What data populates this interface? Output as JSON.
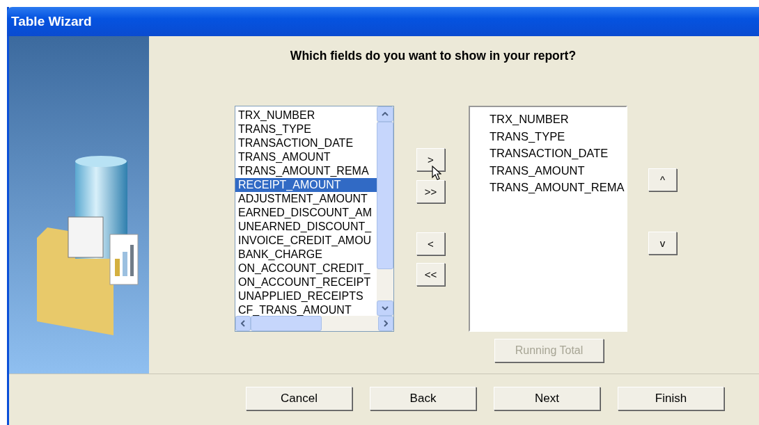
{
  "window": {
    "title": "Table Wizard"
  },
  "heading": "Which fields do you want to show in your report?",
  "available_fields": [
    {
      "label": "TRX_NUMBER",
      "selected": false
    },
    {
      "label": "TRANS_TYPE",
      "selected": false
    },
    {
      "label": "TRANSACTION_DATE",
      "selected": false
    },
    {
      "label": "TRANS_AMOUNT",
      "selected": false
    },
    {
      "label": "TRANS_AMOUNT_REMA",
      "selected": false
    },
    {
      "label": "RECEIPT_AMOUNT",
      "selected": true
    },
    {
      "label": "ADJUSTMENT_AMOUNT",
      "selected": false
    },
    {
      "label": "EARNED_DISCOUNT_AM",
      "selected": false
    },
    {
      "label": "UNEARNED_DISCOUNT_",
      "selected": false
    },
    {
      "label": "INVOICE_CREDIT_AMOU",
      "selected": false
    },
    {
      "label": "BANK_CHARGE",
      "selected": false
    },
    {
      "label": "ON_ACCOUNT_CREDIT_",
      "selected": false
    },
    {
      "label": "ON_ACCOUNT_RECEIPT",
      "selected": false
    },
    {
      "label": "UNAPPLIED_RECEIPTS",
      "selected": false
    },
    {
      "label": "CF_TRANS_AMOUNT",
      "selected": false
    }
  ],
  "move_buttons": [
    ">",
    ">>",
    "<",
    "<<"
  ],
  "selected_fields": [
    "TRX_NUMBER",
    "TRANS_TYPE",
    "TRANSACTION_DATE",
    "TRANS_AMOUNT",
    "TRANS_AMOUNT_REMA"
  ],
  "order_buttons": [
    "^",
    "v"
  ],
  "running_total": {
    "label": "Running Total",
    "disabled": true
  },
  "footer_buttons": [
    "Cancel",
    "Back",
    "Next",
    "Finish"
  ]
}
